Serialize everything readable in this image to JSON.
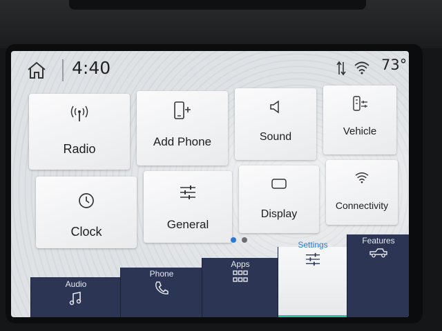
{
  "status_bar": {
    "time": "4:40",
    "temperature": "73°",
    "icons": [
      "home-icon",
      "signal-arrows-icon",
      "wifi-icon"
    ]
  },
  "tiles": [
    {
      "label": "Radio",
      "icon": "radio-icon"
    },
    {
      "label": "Add Phone",
      "icon": "add-phone-icon"
    },
    {
      "label": "Sound",
      "icon": "speaker-icon"
    },
    {
      "label": "Vehicle",
      "icon": "vehicle-settings-icon"
    },
    {
      "label": "Clock",
      "icon": "clock-icon"
    },
    {
      "label": "General",
      "icon": "sliders-icon"
    },
    {
      "label": "Display",
      "icon": "display-icon"
    },
    {
      "label": "Connectivity",
      "icon": "wifi-icon"
    }
  ],
  "pagination": {
    "pages": 2,
    "current": 1
  },
  "tabs": [
    {
      "label": "Audio",
      "icon": "music-note-icon"
    },
    {
      "label": "Phone",
      "icon": "phone-handset-icon"
    },
    {
      "label": "Apps",
      "icon": "apps-grid-icon"
    },
    {
      "label": "Settings",
      "icon": "sliders-icon",
      "active": true
    },
    {
      "label": "Features",
      "icon": "truck-icon"
    }
  ],
  "colors": {
    "tab_background": "#2c3654",
    "active_tab_text": "#2b7bd6",
    "active_indicator": "#2fc2a9",
    "page_dot_active": "#2b7bd6"
  }
}
